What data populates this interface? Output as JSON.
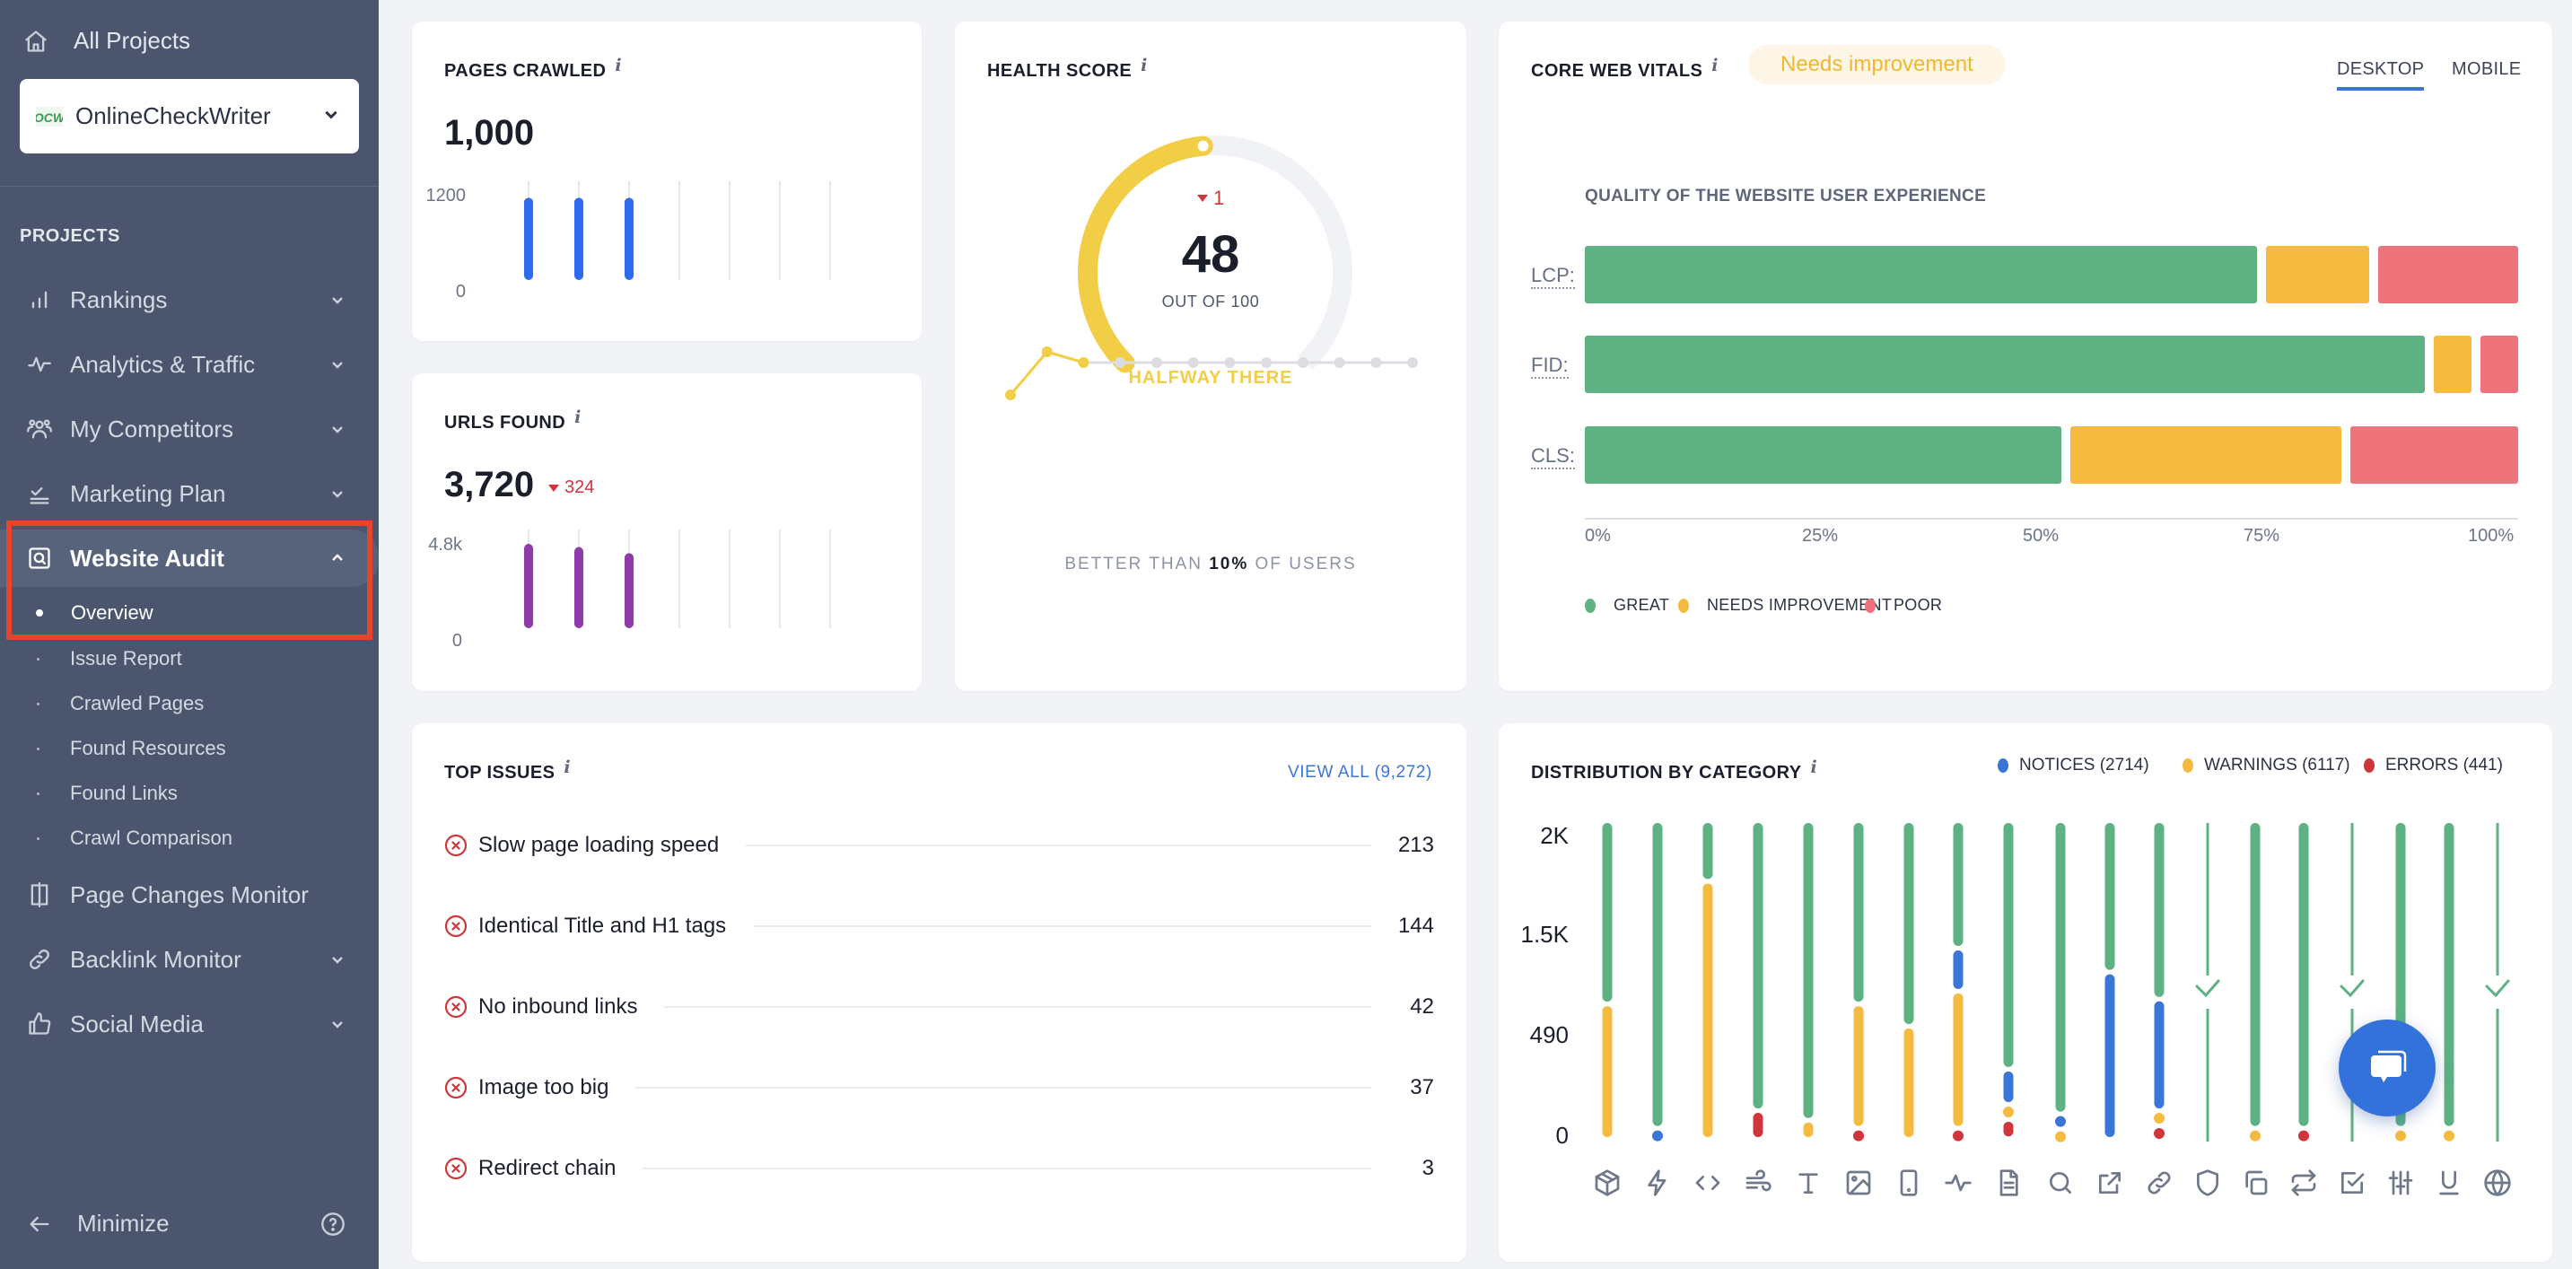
{
  "sidebar": {
    "all_projects": "All Projects",
    "project": {
      "name": "OnlineCheckWriter",
      "logo_text": "OCW"
    },
    "section_label": "PROJECTS",
    "nav": [
      {
        "label": "Rankings",
        "icon": "bar-chart-icon",
        "expandable": true,
        "expanded": false
      },
      {
        "label": "Analytics & Traffic",
        "icon": "pulse-icon",
        "expandable": true,
        "expanded": false
      },
      {
        "label": "My Competitors",
        "icon": "users-icon",
        "expandable": true,
        "expanded": false
      },
      {
        "label": "Marketing Plan",
        "icon": "checklist-icon",
        "expandable": true,
        "expanded": false
      },
      {
        "label": "Website Audit",
        "icon": "audit-search-icon",
        "expandable": true,
        "expanded": true,
        "active": true
      },
      {
        "label": "Page Changes Monitor",
        "icon": "compare-icon",
        "expandable": false
      },
      {
        "label": "Backlink Monitor",
        "icon": "link-icon",
        "expandable": true,
        "expanded": false
      },
      {
        "label": "Social Media",
        "icon": "thumbs-up-icon",
        "expandable": true,
        "expanded": false
      }
    ],
    "audit_subitems": [
      {
        "label": "Overview",
        "active": true
      },
      {
        "label": "Issue Report"
      },
      {
        "label": "Crawled Pages"
      },
      {
        "label": "Found Resources"
      },
      {
        "label": "Found Links"
      },
      {
        "label": "Crawl Comparison"
      }
    ],
    "minimize": "Minimize"
  },
  "pages_crawled": {
    "title": "PAGES CRAWLED",
    "value": "1,000",
    "y_max_label": "1200",
    "y_min_label": "0",
    "y_max": 1200,
    "bars": [
      1000,
      1000,
      1000,
      null,
      null,
      null,
      null
    ],
    "color": "#2f6bef"
  },
  "urls_found": {
    "title": "URLS FOUND",
    "value": "3,720",
    "delta": "324",
    "delta_direction": "down",
    "y_max_label": "4.8k",
    "y_min_label": "0",
    "y_max": 4800,
    "bars": [
      4100,
      3950,
      3650,
      null,
      null,
      null,
      null
    ],
    "color": "#8e3aa8"
  },
  "health_score": {
    "title": "HEALTH SCORE",
    "score": "48",
    "score_value": 48,
    "out_of": "OUT OF 100",
    "delta": "1",
    "delta_direction": "down",
    "status": "HALFWAY THERE",
    "history": [
      42,
      50,
      48,
      null,
      null,
      null,
      null,
      null,
      null,
      null,
      null,
      null
    ],
    "better_than_prefix": "BETTER THAN",
    "better_than_value": "10%",
    "better_than_suffix": "OF USERS",
    "color": "#f2cd46"
  },
  "core_web_vitals": {
    "title": "CORE WEB VITALS",
    "status_pill": "Needs improvement",
    "tabs": [
      {
        "label": "DESKTOP",
        "active": true
      },
      {
        "label": "MOBILE",
        "active": false
      }
    ],
    "chart_title": "QUALITY OF THE WEBSITE USER EXPERIENCE",
    "axis_ticks": [
      "0%",
      "25%",
      "50%",
      "75%",
      "100%"
    ],
    "legend": [
      {
        "label": "GREAT",
        "color": "#5eb183"
      },
      {
        "label": "NEEDS IMPROVEMENT",
        "color": "#f4bb40"
      },
      {
        "label": "POOR",
        "color": "#ee737a"
      }
    ]
  },
  "top_issues": {
    "title": "TOP ISSUES",
    "view_all": "VIEW ALL (9,272)",
    "items": [
      {
        "label": "Slow page loading speed",
        "count": "213"
      },
      {
        "label": "Identical Title and H1 tags",
        "count": "144"
      },
      {
        "label": "No inbound links",
        "count": "42"
      },
      {
        "label": "Image too big",
        "count": "37"
      },
      {
        "label": "Redirect chain",
        "count": "3"
      }
    ]
  },
  "distribution": {
    "title": "DISTRIBUTION BY CATEGORY",
    "legend": [
      {
        "label": "NOTICES (2714)",
        "color": "#3a76d8"
      },
      {
        "label": "WARNINGS (6117)",
        "color": "#f4bb40"
      },
      {
        "label": "ERRORS (441)",
        "color": "#d0353a"
      }
    ],
    "y_labels": [
      "2K",
      "1.5K",
      "490",
      "0"
    ]
  },
  "chart_data": [
    {
      "type": "bar",
      "title": "Pages Crawled",
      "categories": [
        "1",
        "2",
        "3",
        "4",
        "5",
        "6",
        "7"
      ],
      "values": [
        1000,
        1000,
        1000,
        null,
        null,
        null,
        null
      ],
      "ylim": [
        0,
        1200
      ],
      "ytick_labels": [
        "0",
        "1200"
      ]
    },
    {
      "type": "bar",
      "title": "URLs Found",
      "categories": [
        "1",
        "2",
        "3",
        "4",
        "5",
        "6",
        "7"
      ],
      "values": [
        4100,
        3950,
        3650,
        null,
        null,
        null,
        null
      ],
      "ylim": [
        0,
        4800
      ],
      "ytick_labels": [
        "0",
        "4.8k"
      ]
    },
    {
      "type": "line",
      "title": "Health Score history",
      "x": [
        1,
        2,
        3,
        4,
        5,
        6,
        7,
        8,
        9,
        10,
        11,
        12
      ],
      "values": [
        42,
        50,
        48,
        null,
        null,
        null,
        null,
        null,
        null,
        null,
        null,
        null
      ]
    },
    {
      "type": "bar",
      "orientation": "horizontal-stacked-percent",
      "title": "QUALITY OF THE WEBSITE USER EXPERIENCE",
      "categories": [
        "LCP:",
        "FID:",
        "CLS:"
      ],
      "series": [
        {
          "name": "GREAT",
          "values": [
            73,
            91,
            52
          ]
        },
        {
          "name": "NEEDS IMPROVEMENT",
          "values": [
            12,
            5,
            30
          ]
        },
        {
          "name": "POOR",
          "values": [
            15,
            4,
            18
          ]
        }
      ],
      "xlim": [
        0,
        100
      ],
      "xtick_labels": [
        "0%",
        "25%",
        "50%",
        "75%",
        "100%"
      ],
      "legend": "bottom-left"
    },
    {
      "type": "bar",
      "orientation": "vertical-stacked-share",
      "title": "DISTRIBUTION BY CATEGORY",
      "categories": [
        "crawlability",
        "performance",
        "code",
        "redirects",
        "text",
        "images",
        "mobile",
        "activity",
        "content",
        "search",
        "external-links",
        "links",
        "security",
        "duplicates",
        "canonical",
        "validation",
        "parameters",
        "underline",
        "international"
      ],
      "category_icons": [
        "cube-icon",
        "lightning-icon",
        "code-icon",
        "wind-icon",
        "text-icon",
        "image-icon",
        "mobile-icon",
        "pulse-icon",
        "document-icon",
        "search-icon",
        "external-link-icon",
        "link-icon",
        "shield-icon",
        "copy-icon",
        "repeat-icon",
        "checkbox-icon",
        "sliders-icon",
        "underline-icon",
        "globe-icon"
      ],
      "series": [
        {
          "name": "PASSED",
          "values": [
            0.575,
            0.965,
            0.19,
            0.91,
            0.94,
            0.575,
            0.645,
            0.4,
            0.78,
            0.92,
            0.475,
            0.56,
            1,
            0.965,
            0.965,
            1,
            0.965,
            0.965,
            1
          ]
        },
        {
          "name": "NOTICES",
          "values": [
            0,
            0.035,
            0,
            0,
            0,
            0,
            0,
            0.135,
            0.11,
            0.035,
            0.525,
            0.35,
            0,
            0,
            0,
            0,
            0,
            0,
            0
          ]
        },
        {
          "name": "WARNINGS",
          "values": [
            0.425,
            0,
            0.81,
            0,
            0.06,
            0.39,
            0.355,
            0.43,
            0.03,
            0.035,
            0,
            0.035,
            0,
            0.035,
            0,
            0,
            0.035,
            0.035,
            0
          ]
        },
        {
          "name": "ERRORS",
          "values": [
            0,
            0,
            0,
            0.09,
            0,
            0.035,
            0,
            0.035,
            0.06,
            0,
            0,
            0.035,
            0,
            0,
            0.035,
            0,
            0,
            0,
            0
          ]
        }
      ],
      "all_passed": [
        false,
        false,
        false,
        false,
        false,
        false,
        false,
        false,
        false,
        false,
        false,
        false,
        true,
        false,
        false,
        true,
        false,
        false,
        true
      ],
      "ytick_labels": [
        "0",
        "490",
        "1.5K",
        "2K"
      ],
      "legend": "top-right"
    }
  ],
  "colors": {
    "great": "#5eb183",
    "needs_improvement": "#f4bb40",
    "poor": "#ee737a",
    "notice": "#3a76d8",
    "warning": "#f4bb40",
    "error": "#d0353a",
    "passed": "#5eb183",
    "accent": "#3a76d8",
    "sidebar_bg": "#4b566e",
    "highlight": "#e8432b"
  }
}
